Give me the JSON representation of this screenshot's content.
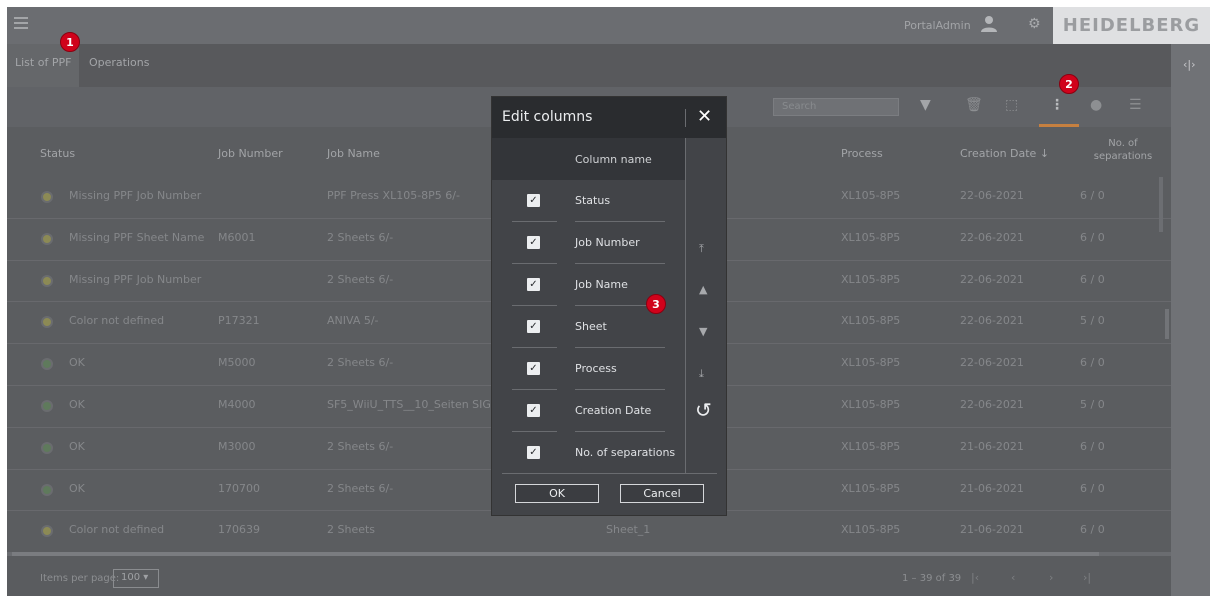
{
  "topbar": {
    "user": "PortalAdmin",
    "brand": "HEIDELBERG"
  },
  "tabs": [
    "List of PPF",
    "Operations"
  ],
  "toolbar": {
    "search_placeholder": "Search"
  },
  "columns": [
    "Status",
    "Job Number",
    "Job Name",
    "Process",
    "Creation Date ↓",
    "No. of separations"
  ],
  "rows": [
    {
      "status": "Missing PPF Job Number",
      "state": "warn",
      "job_number": "",
      "job_name": "PPF Press XL105-8P5 6/-",
      "sheet": "",
      "process": "XL105-8P5",
      "date": "22-06-2021",
      "sep": "6 / 0"
    },
    {
      "status": "Missing PPF Sheet Name",
      "state": "warn",
      "job_number": "M6001",
      "job_name": "2 Sheets 6/-",
      "sheet": "",
      "process": "XL105-8P5",
      "date": "22-06-2021",
      "sep": "6 / 0"
    },
    {
      "status": "Missing PPF Job Number",
      "state": "warn",
      "job_number": "",
      "job_name": "2 Sheets 6/-",
      "sheet": "",
      "process": "XL105-8P5",
      "date": "22-06-2021",
      "sep": "6 / 0"
    },
    {
      "status": "Color not defined",
      "state": "warn",
      "job_number": "P17321",
      "job_name": "ANIVA 5/-",
      "sheet": "",
      "process": "XL105-8P5",
      "date": "22-06-2021",
      "sep": "5 / 0"
    },
    {
      "status": "OK",
      "state": "ok",
      "job_number": "M5000",
      "job_name": "2 Sheets 6/-",
      "sheet": "",
      "process": "XL105-8P5",
      "date": "22-06-2021",
      "sep": "6 / 0"
    },
    {
      "status": "OK",
      "state": "ok",
      "job_number": "M4000",
      "job_name": "SF5_WiiU_TTS__10_Seiten SIG",
      "sheet": "",
      "process": "XL105-8P5",
      "date": "22-06-2021",
      "sep": "5 / 0"
    },
    {
      "status": "OK",
      "state": "ok",
      "job_number": "M3000",
      "job_name": "2 Sheets 6/-",
      "sheet": "",
      "process": "XL105-8P5",
      "date": "21-06-2021",
      "sep": "6 / 0"
    },
    {
      "status": "OK",
      "state": "ok",
      "job_number": "170700",
      "job_name": "2 Sheets 6/-",
      "sheet": "",
      "process": "XL105-8P5",
      "date": "21-06-2021",
      "sep": "6 / 0"
    },
    {
      "status": "Color not defined",
      "state": "warn",
      "job_number": "170639",
      "job_name": "2 Sheets",
      "sheet": "Sheet_1",
      "process": "XL105-8P5",
      "date": "21-06-2021",
      "sep": "6 / 0"
    }
  ],
  "footer": {
    "items_per_page_label": "Items per page:",
    "items_per_page": "100",
    "range": "1 – 39 of 39"
  },
  "modal": {
    "title": "Edit columns",
    "column_header": "Column name",
    "items": [
      "Status",
      "Job Number",
      "Job Name",
      "Sheet",
      "Process",
      "Creation Date",
      "No. of separations"
    ],
    "ok": "OK",
    "cancel": "Cancel"
  },
  "callouts": [
    "1",
    "2",
    "3"
  ],
  "colors": {
    "accent": "#c68040",
    "callout": "#d0021b"
  }
}
